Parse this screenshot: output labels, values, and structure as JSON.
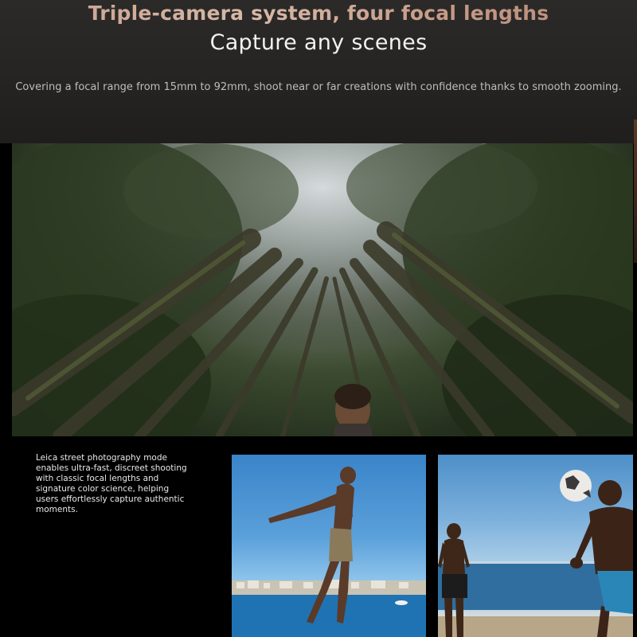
{
  "hero": {
    "headline": "Triple-camera system, four focal lengths",
    "subheadline": "Capture any scenes",
    "description": "Covering a focal range from 15mm to 92mm, shoot near or far creations with confidence thanks to smooth zooming."
  },
  "feature": {
    "leica_description": "Leica street photography mode enables ultra-fast, discreet shooting with classic focal lengths and signature color science, helping users effortlessly capture authentic moments."
  },
  "images": {
    "main": "forest-canopy-photo",
    "left": "jumping-man-over-sea-photo",
    "right": "beach-football-photo"
  },
  "colors": {
    "headline_gradient_start": "#c79f8d",
    "headline_gradient_end": "#b48a78",
    "background": "#000000",
    "hero_background": "#262524"
  }
}
